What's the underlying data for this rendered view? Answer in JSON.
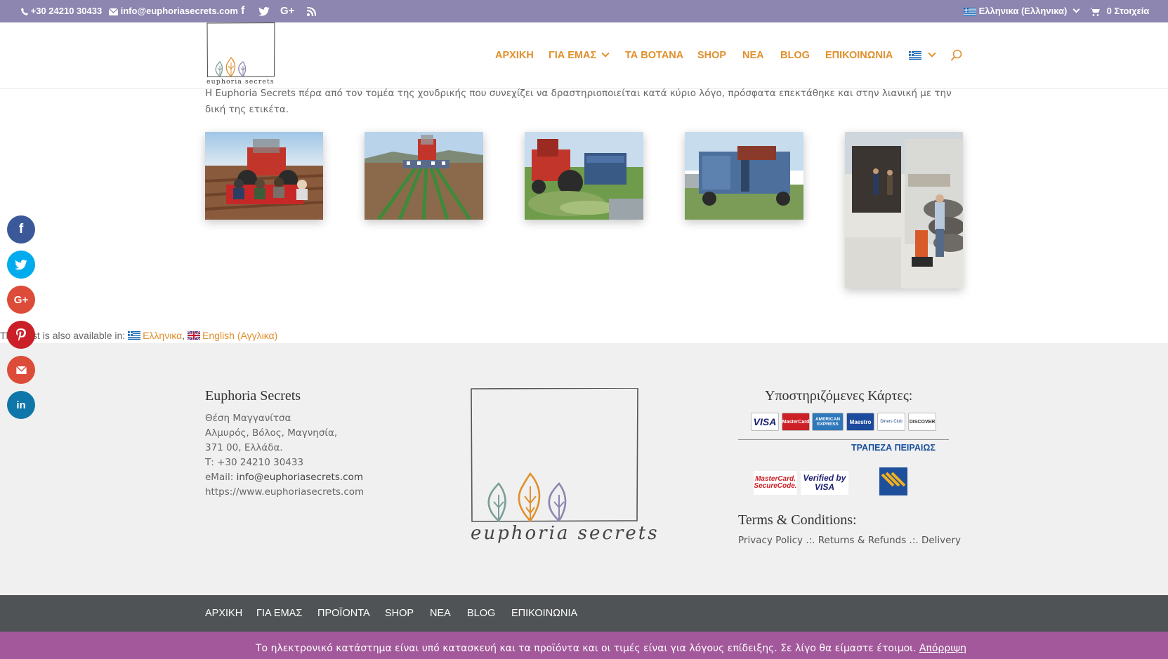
{
  "topbar": {
    "phone": "+30 24210 30433",
    "email": "info@euphoriasecrets.com",
    "language": "Ελληνικα (Ελληνικα)",
    "cart": "0 Στοιχεία"
  },
  "logo": {
    "text": "euphoria secrets"
  },
  "nav": {
    "items": [
      {
        "label": "ΑΡΧΙΚΗ"
      },
      {
        "label": "ΓΙΑ ΕΜΑΣ"
      },
      {
        "label": "ΤΑ ΒΟΤΑΝΑ"
      },
      {
        "label": "SHOP"
      },
      {
        "label": "ΝΕΑ"
      },
      {
        "label": "BLOG"
      },
      {
        "label": "ΕΠΙΚΟΙΝΩΝΙΑ"
      }
    ]
  },
  "content": {
    "intro": "Η Euphoria Secrets πέρα από τον τομέα της χονδρικής που συνεχίζει να δραστηριοποιείται κατά κύριο λόγο, πρόσφατα επεκτάθηκε και στην λιανική με την δική της ετικέτα.",
    "gallery": [
      {
        "icon": "tractor-planting-photo"
      },
      {
        "icon": "tractor-field-rows-photo"
      },
      {
        "icon": "red-tractor-harvest-photo"
      },
      {
        "icon": "harvest-machine-photo"
      },
      {
        "icon": "truck-loading-forklift-photo"
      }
    ]
  },
  "availability": {
    "prefix": "This post is also available in:",
    "lang1": "Ελληνικα",
    "sep": ",",
    "lang2": "English (Αγγλικα)"
  },
  "footer": {
    "company": {
      "title": "Euphoria Secrets",
      "line1": "Θέση Μαγγανίτσα",
      "line2": "Αλμυρός, Βόλος, Μαγνησία,",
      "line3": "371 00, Ελλάδα.",
      "phone": "Τ: +30 24210 30433",
      "email_label": "eMail:",
      "email": "info@euphoriasecrets.com",
      "website": "https://www.euphoriasecrets.com"
    },
    "logo_text": "euphoria secrets",
    "cards": {
      "title": "Υποστηριζόμενες Κάρτες:",
      "visa": "VISA",
      "mastercard": "MasterCard",
      "amex": "AMERICAN EXPRESS",
      "maestro": "Maestro",
      "diners": "Diners Club",
      "discover": "DISCOVER",
      "bank": "ΤΡΑΠΕΖΑ ΠΕΙΡΑΙΩΣ",
      "securecode": "MasterCard. SecureCode.",
      "verified": "Verified by VISA"
    },
    "terms": {
      "title": "Terms & Conditions:",
      "privacy": "Privacy Policy",
      "sep1": ".:.",
      "returns": "Returns & Refunds",
      "sep2": ".:.",
      "delivery": "Delivery"
    }
  },
  "bottom_nav": {
    "items": [
      {
        "label": "ΑΡΧΙΚΗ"
      },
      {
        "label": "ΓΙΑ ΕΜΑΣ"
      },
      {
        "label": "ΠΡΟΪΟΝΤΑ"
      },
      {
        "label": "SHOP"
      },
      {
        "label": "ΝΕΑ"
      },
      {
        "label": "BLOG"
      },
      {
        "label": "ΕΠΙΚΟΙΝΩΝΙΑ"
      }
    ]
  },
  "cookie": {
    "message": "Το ηλεκτρονικό κατάστημα είναι υπό κατασκευή και τα προϊόντα και οι τιμές είναι για λόγους επίδειξης. Σε λίγο θα είμαστε έτοιμοι.",
    "dismiss": "Απόρριψη"
  },
  "social": {
    "facebook": "f",
    "googleplus": "G+",
    "linkedin": "in"
  },
  "colors": {
    "topbar": "#8d86b0",
    "accent": "#e0902d",
    "footer_bg": "#f0f0f0",
    "bottom_nav_bg": "#4f5355",
    "cookie_bg": "#a2589a"
  }
}
